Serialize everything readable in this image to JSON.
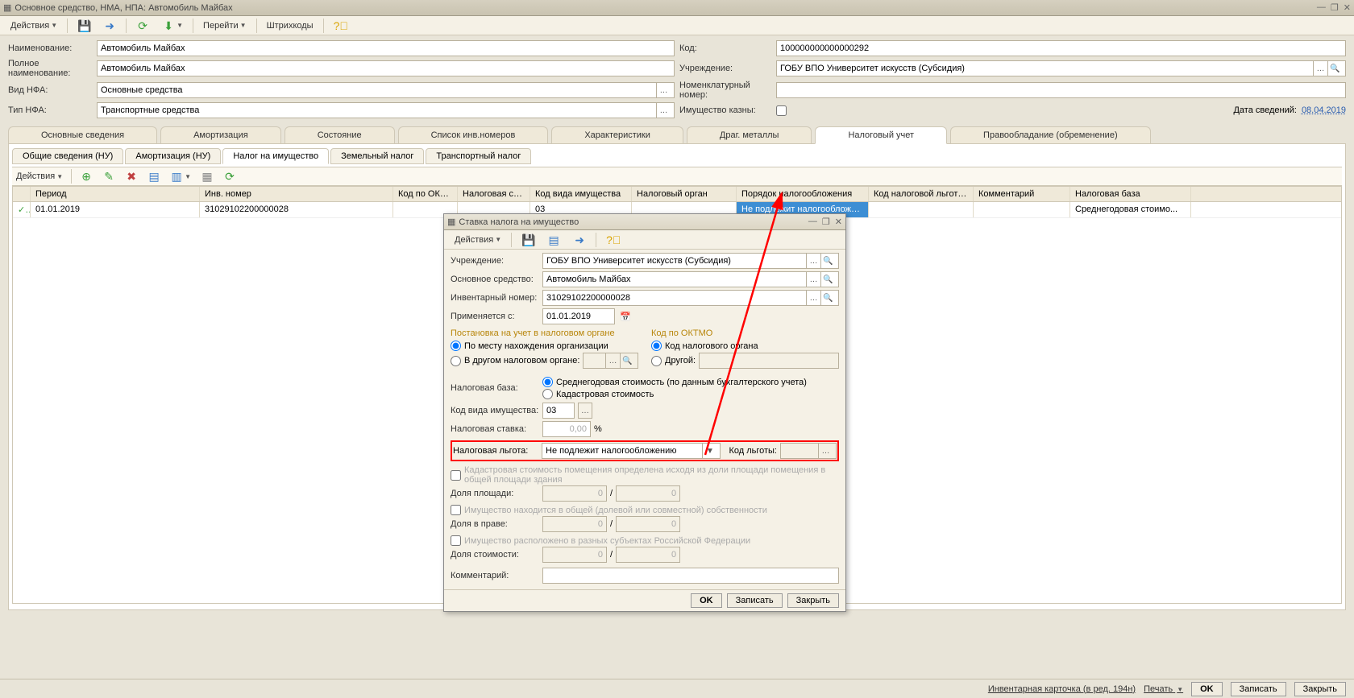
{
  "window": {
    "title": "Основное средство, НМА, НПА: Автомобиль Майбах"
  },
  "toolbar": {
    "actions": "Действия",
    "goto": "Перейти",
    "barcodes": "Штрихкоды"
  },
  "form": {
    "name_lbl": "Наименование:",
    "name_val": "Автомобиль Майбах",
    "fullname_lbl": "Полное наименование:",
    "fullname_val": "Автомобиль Майбах",
    "vidnfa_lbl": "Вид НФА:",
    "vidnfa_val": "Основные средства",
    "tipnfa_lbl": "Тип НФА:",
    "tipnfa_val": "Транспортные средства",
    "code_lbl": "Код:",
    "code_val": "100000000000000292",
    "org_lbl": "Учреждение:",
    "org_val": "ГОБУ ВПО Университет искусств (Субсидия)",
    "nomen_lbl": "Номенклатурный номер:",
    "nomen_val": "",
    "treasury_lbl": "Имущество казны:",
    "datainfo_lbl": "Дата сведений:",
    "datainfo_val": "08.04.2019"
  },
  "maintabs": [
    "Основные сведения",
    "Амортизация",
    "Состояние",
    "Список инв.номеров",
    "Характеристики",
    "Драг. металлы",
    "Налоговый учет",
    "Правообладание (обременение)"
  ],
  "maintabs_active": 6,
  "subtabs": [
    "Общие сведения (НУ)",
    "Амортизация (НУ)",
    "Налог на имущество",
    "Земельный налог",
    "Транспортный налог"
  ],
  "subtabs_active": 2,
  "subtoolbar_actions": "Действия",
  "grid": {
    "cols": [
      "",
      "Период",
      "Инв. номер",
      "Код по ОКТМО",
      "Налоговая став...",
      "Код вида имущества",
      "Налоговый орган",
      "Порядок налогообложения",
      "Код налоговой льготы (о...",
      "Комментарий",
      "Налоговая база"
    ],
    "widths": [
      22,
      210,
      240,
      80,
      90,
      126,
      130,
      164,
      130,
      120,
      150
    ],
    "row": [
      "",
      "01.01.2019",
      "31029102200000028",
      "",
      "",
      "03",
      "",
      "Не подлежит налогообложению",
      "",
      "",
      "Среднегодовая стоимо..."
    ],
    "hlcol": 7
  },
  "dialog": {
    "title": "Ставка налога на имущество",
    "actions": "Действия",
    "org_lbl": "Учреждение:",
    "org_val": "ГОБУ ВПО Университет искусств (Субсидия)",
    "os_lbl": "Основное средство:",
    "os_val": "Автомобиль Майбах",
    "inv_lbl": "Инвентарный номер:",
    "inv_val": "31029102200000028",
    "from_lbl": "Применяется с:",
    "from_val": "01.01.2019",
    "reg_head": "Постановка на учет в налоговом органе",
    "oktmo_head": "Код по ОКТМО",
    "radio1": "По месту нахождения организации",
    "radio2": "В другом налоговом органе:",
    "radio3": "Код налогового органа",
    "radio4": "Другой:",
    "base_lbl": "Налоговая база:",
    "base_r1": "Среднегодовая стоимость (по данным бухгалтерского учета)",
    "base_r2": "Кадастровая стоимость",
    "kvi_lbl": "Код вида имущества:",
    "kvi_val": "03",
    "rate_lbl": "Налоговая ставка:",
    "rate_val": "0,00",
    "rate_unit": "%",
    "ben_lbl": "Налоговая льгота:",
    "ben_val": "Не подлежит налогообложению",
    "bencode_lbl": "Код льготы:",
    "cad_chk": "Кадастровая стоимость помещения определена исходя из доли площади помещения в общей площади здания",
    "area_lbl": "Доля площади:",
    "zero": "0",
    "shared_chk": "Имущество находится в общей (долевой или совместной) собственности",
    "share_lbl": "Доля в праве:",
    "regions_chk": "Имущество расположено в разных субъектах Российской Федерации",
    "cost_lbl": "Доля стоимости:",
    "comment_lbl": "Комментарий:",
    "ok": "OK",
    "save": "Записать",
    "close": "Закрыть"
  },
  "footer": {
    "invcard": "Инвентарная карточка (в ред. 194н)",
    "print": "Печать",
    "ok": "OK",
    "save": "Записать",
    "close": "Закрыть"
  }
}
